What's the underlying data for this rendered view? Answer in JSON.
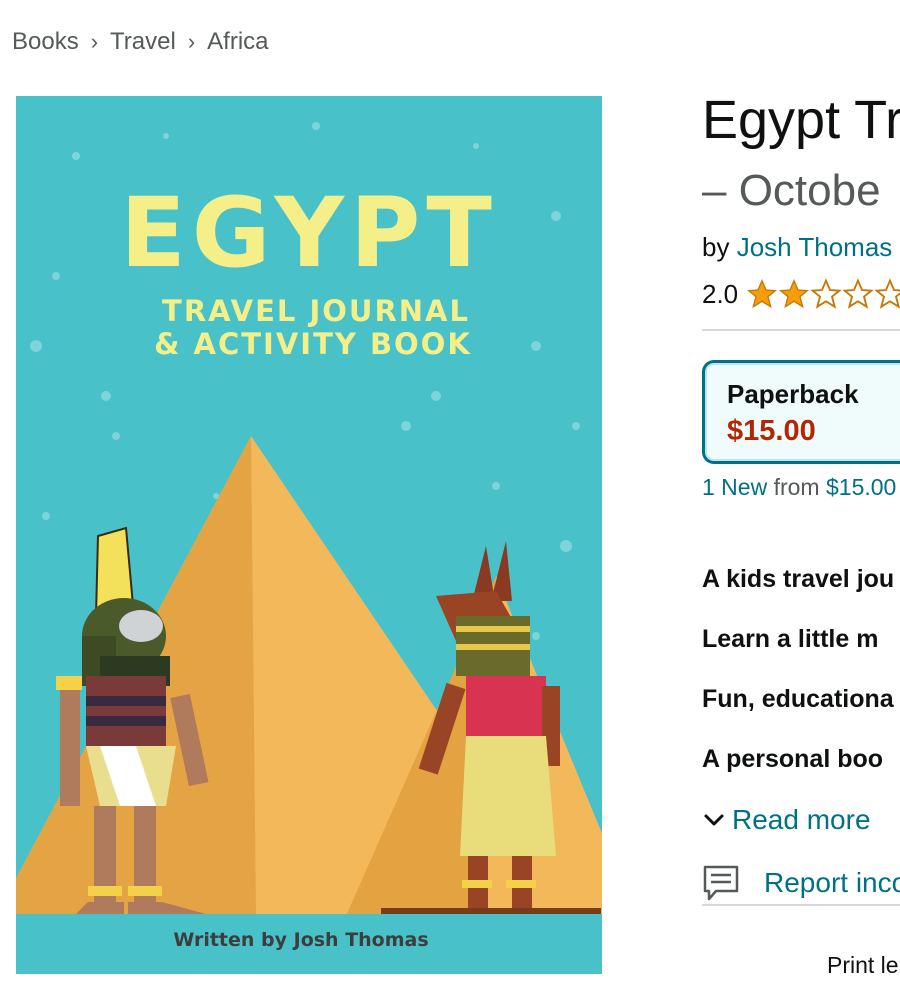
{
  "breadcrumb": {
    "items": [
      "Books",
      "Travel",
      "Africa"
    ],
    "separator": "›"
  },
  "cover": {
    "title": "EGYPT",
    "subtitle_line1": "TRAVEL JOURNAL",
    "subtitle_line2": "& ACTIVITY BOOK",
    "author_credit": "Written by Josh Thomas",
    "colors": {
      "background": "#49c1c9",
      "title": "#f5ef8a",
      "pyramid_light": "#f2b85a",
      "pyramid_dark": "#d9952e"
    }
  },
  "product": {
    "title": "Egypt Tr",
    "subtitle": "– Octobe",
    "by_label": "by",
    "author": "Josh Thomas",
    "rating_value": "2.0",
    "rating_stars": 2,
    "rating_max": 5
  },
  "format": {
    "name": "Paperback",
    "price": "$15.00"
  },
  "offers": {
    "count_label": "1 New",
    "from_label": "from",
    "price": "$15.00"
  },
  "bullets": [
    "A kids travel jou",
    "Learn a little m",
    "Fun, educationa",
    "A personal boo"
  ],
  "read_more": "Read more",
  "report": "Report inco",
  "print_length": "Print le",
  "icons": {
    "chevron": "chevron-down-icon",
    "report": "feedback-icon",
    "star": "star-icon"
  },
  "colors": {
    "link": "#007185",
    "price": "#b12704",
    "star": "#f59e0b"
  }
}
